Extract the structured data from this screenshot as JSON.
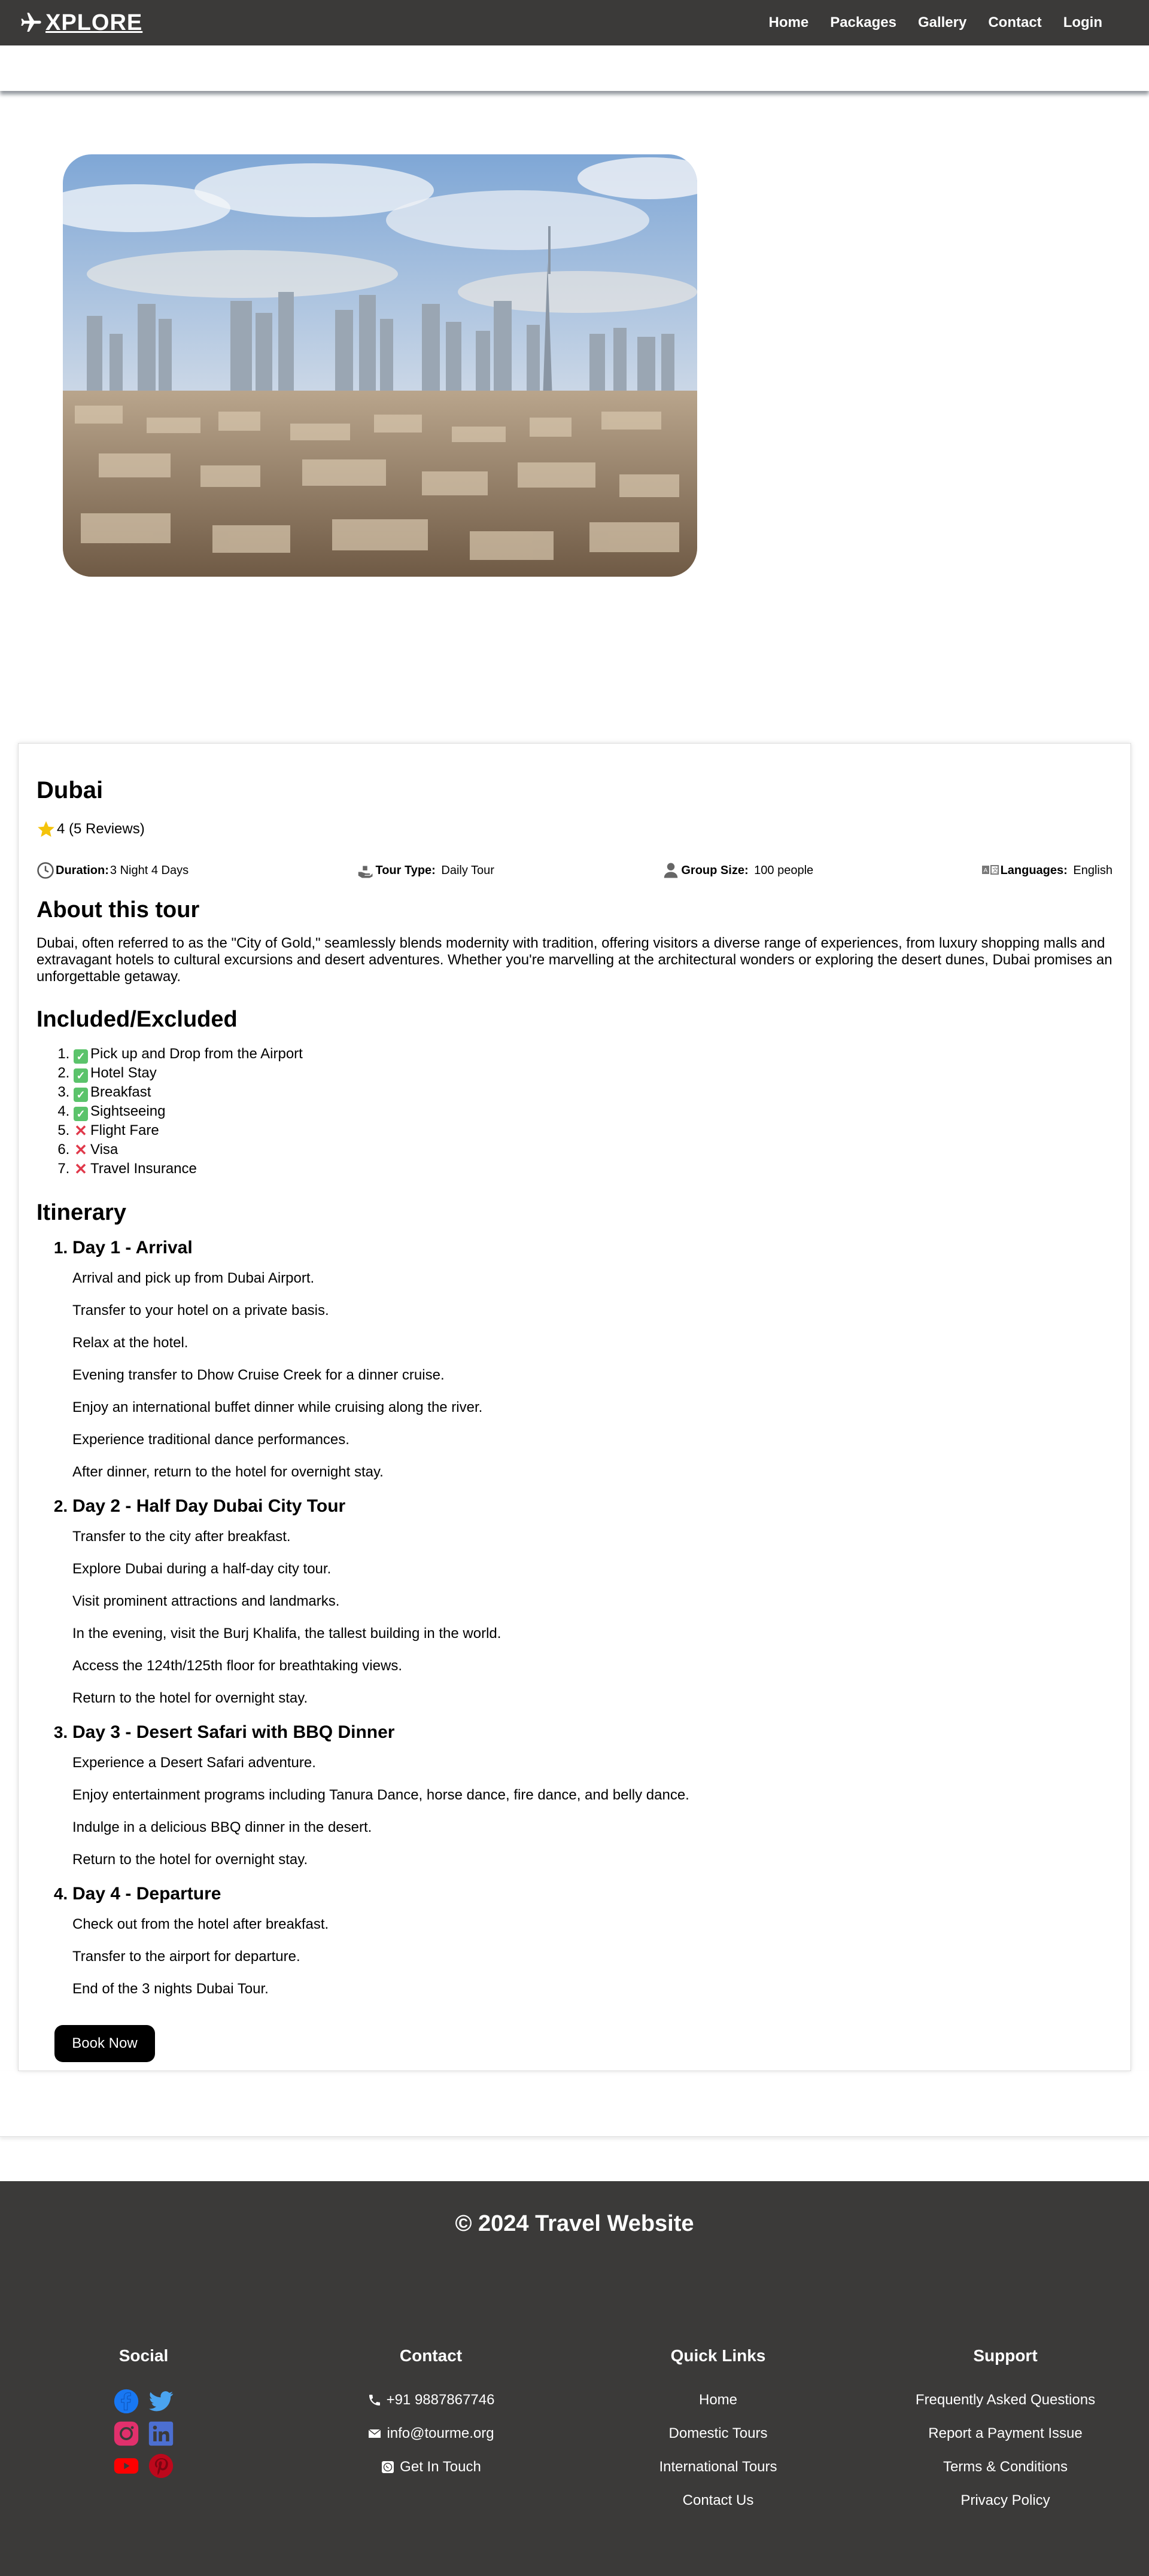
{
  "nav": {
    "logo": "XPLORE",
    "links": [
      "Home",
      "Packages",
      "Gallery",
      "Contact",
      "Login"
    ]
  },
  "hero": {
    "image_alt": "Dubai skyline"
  },
  "tour": {
    "title": "Dubai",
    "rating": "4 (5 Reviews)",
    "duration_label": "Duration:",
    "duration_value": "3 Night 4 Days",
    "type_label": "Tour Type:",
    "type_value": "Daily Tour",
    "group_label": "Group Size:",
    "group_value": "100 people",
    "lang_label": "Languages:",
    "lang_value": "English"
  },
  "about": {
    "heading": "About this tour",
    "text": "Dubai, often referred to as the \"City of Gold,\" seamlessly blends modernity with tradition, offering visitors a diverse range of experiences, from luxury shopping malls and extravagant hotels to cultural excursions and desert adventures. Whether you're marvelling at the architectural wonders or exploring the desert dunes, Dubai promises an unforgettable getaway."
  },
  "included": {
    "heading": "Included/Excluded",
    "items": [
      {
        "text": "Pick up and Drop from the Airport",
        "icon": "check-icon"
      },
      {
        "text": "Hotel Stay",
        "icon": "check-icon"
      },
      {
        "text": "Breakfast",
        "icon": "check-icon"
      },
      {
        "text": "Sightseeing",
        "icon": "check-icon"
      },
      {
        "text": "Flight Fare",
        "icon": "cross-icon"
      },
      {
        "text": "Visa",
        "icon": "cross-icon"
      },
      {
        "text": "Travel Insurance",
        "icon": "cross-icon"
      }
    ]
  },
  "itinerary": {
    "heading": "Itinerary",
    "days": [
      {
        "title": "Day 1 - Arrival",
        "steps": [
          "Arrival and pick up from Dubai Airport.",
          "Transfer to your hotel on a private basis.",
          "Relax at the hotel.",
          "Evening transfer to Dhow Cruise Creek for a dinner cruise.",
          "Enjoy an international buffet dinner while cruising along the river.",
          "Experience traditional dance performances.",
          "After dinner, return to the hotel for overnight stay."
        ]
      },
      {
        "title": "Day 2 - Half Day Dubai City Tour",
        "steps": [
          "Transfer to the city after breakfast.",
          "Explore Dubai during a half-day city tour.",
          "Visit prominent attractions and landmarks.",
          "In the evening, visit the Burj Khalifa, the tallest building in the world.",
          "Access the 124th/125th floor for breathtaking views.",
          "Return to the hotel for overnight stay."
        ]
      },
      {
        "title": "Day 3 - Desert Safari with BBQ Dinner",
        "steps": [
          "Experience a Desert Safari adventure.",
          "Enjoy entertainment programs including Tanura Dance, horse dance, fire dance, and belly dance.",
          "Indulge in a delicious BBQ dinner in the desert.",
          "Return to the hotel for overnight stay."
        ]
      },
      {
        "title": "Day 4 - Departure",
        "steps": [
          "Check out from the hotel after breakfast.",
          "Transfer to the airport for departure.",
          "End of the 3 nights Dubai Tour."
        ]
      }
    ]
  },
  "book_button": "Book Now",
  "footer": {
    "copyright": "© 2024 Travel Website",
    "social_heading": "Social",
    "contact_heading": "Contact",
    "phone": "+91 9887867746",
    "email": "info@tourme.org",
    "whatsapp": "Get In Touch",
    "quick_heading": "Quick Links",
    "quick_links": [
      "Home",
      "Domestic Tours",
      "International Tours",
      "Contact Us"
    ],
    "support_heading": "Support",
    "support_links": [
      "Frequently Asked Questions",
      "Report a Payment Issue",
      "Terms & Conditions",
      "Privacy Policy"
    ]
  },
  "colors": {
    "nav_bg": "#3b3a39",
    "check": "#5bc36b",
    "cross": "#e0384a",
    "facebook": "#1877f2",
    "twitter": "#1da1f2",
    "instagram": "#e1306c",
    "linkedin": "#0a66c2",
    "youtube": "#ff0000",
    "pinterest": "#bd081c"
  }
}
